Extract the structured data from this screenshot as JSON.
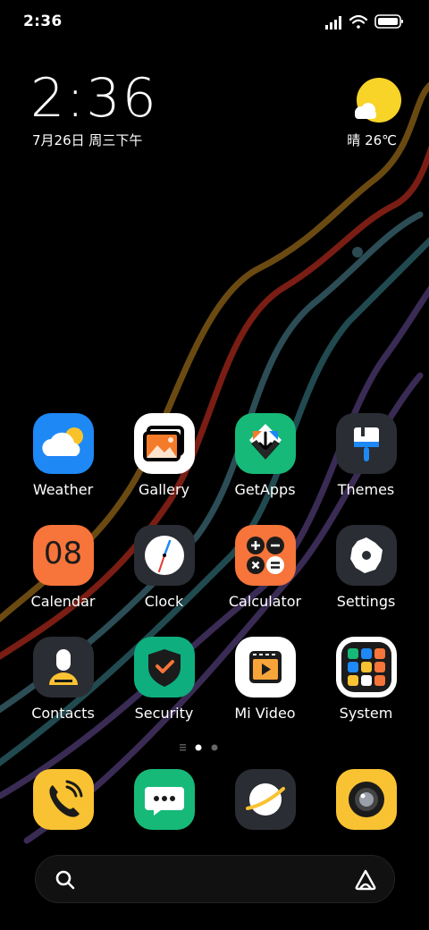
{
  "status_bar": {
    "time": "2:36"
  },
  "clock_widget": {
    "time": "2:36",
    "date": "7月26日 周三下午"
  },
  "weather_widget": {
    "text": "晴 26℃"
  },
  "apps": [
    {
      "name": "weather",
      "label": "Weather"
    },
    {
      "name": "gallery",
      "label": "Gallery"
    },
    {
      "name": "getapps",
      "label": "GetApps"
    },
    {
      "name": "themes",
      "label": "Themes"
    },
    {
      "name": "calendar",
      "label": "Calendar",
      "icon_text": "08"
    },
    {
      "name": "clock",
      "label": "Clock"
    },
    {
      "name": "calculator",
      "label": "Calculator"
    },
    {
      "name": "settings",
      "label": "Settings"
    },
    {
      "name": "contacts",
      "label": "Contacts"
    },
    {
      "name": "security",
      "label": "Security"
    },
    {
      "name": "mi-video",
      "label": "Mi Video"
    },
    {
      "name": "system",
      "label": "System"
    }
  ],
  "page_indicator": {
    "current": 1,
    "total": 2
  },
  "dock": [
    "phone",
    "messages",
    "browser",
    "camera"
  ],
  "colors": {
    "weather_blue": "#1E88F5",
    "getapps_green": "#17B978",
    "calc_orange": "#F7743A",
    "dock_yellow": "#F9C232",
    "security_green": "#0FAE7E"
  }
}
